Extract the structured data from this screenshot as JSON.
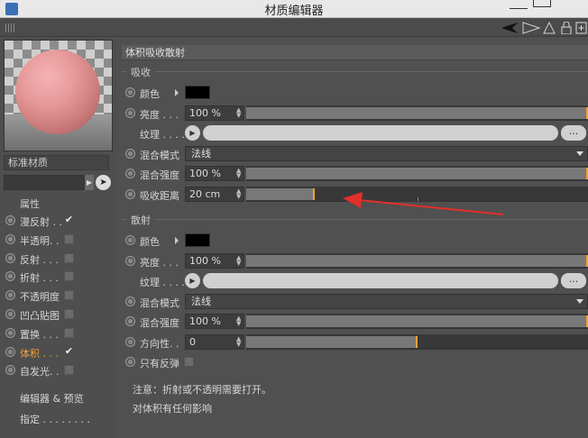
{
  "window": {
    "title": "材质编辑器"
  },
  "left_panel": {
    "material_name": "标准材质",
    "section_title": "属性",
    "channels": [
      {
        "label": "漫反射 . .",
        "checked": true
      },
      {
        "label": "半透明. .",
        "checked": false
      },
      {
        "label": "反射 . . .",
        "checked": false
      },
      {
        "label": "折射 . . .",
        "checked": false
      },
      {
        "label": "不透明度",
        "checked": false
      },
      {
        "label": "凹凸贴图",
        "checked": false
      },
      {
        "label": "置换 . . .",
        "checked": false
      },
      {
        "label": "体积 . . .",
        "checked": true,
        "active": true
      },
      {
        "label": "自发光. .",
        "checked": false
      }
    ],
    "footer": {
      "editor_preview": "编辑器 & 预览",
      "assign": "指定 . . . . . . . ."
    }
  },
  "main": {
    "header": "体积吸收散射",
    "absorption": {
      "group_title": "吸收",
      "color_label": "颜色",
      "brightness_label": "亮度 . . .",
      "brightness_value": "100 %",
      "brightness_level": 1.0,
      "texture_label": "纹理 . . . .",
      "texture_more": "...",
      "blend_mode_label": "混合模式",
      "blend_mode_value": "法线",
      "blend_strength_label": "混合强度",
      "blend_strength_value": "100 %",
      "blend_strength_level": 1.0,
      "distance_label": "吸收距离",
      "distance_value": "20 cm",
      "distance_level": 0.2
    },
    "scattering": {
      "group_title": "散射",
      "color_label": "颜色",
      "brightness_label": "亮度 . . .",
      "brightness_value": "100 %",
      "brightness_level": 1.0,
      "texture_label": "纹理 . . . .",
      "texture_more": "...",
      "blend_mode_label": "混合模式",
      "blend_mode_value": "法线",
      "blend_strength_label": "混合强度",
      "blend_strength_value": "100 %",
      "blend_strength_level": 1.0,
      "direction_label": "方向性. .",
      "direction_value": "0",
      "direction_level": 0.5,
      "only_reflection_label": "只有反弹"
    },
    "notes": [
      "注意：折射或不透明需要打开。",
      "对体积有任何影响"
    ]
  },
  "colors": {
    "accent": "#f0a23a",
    "annotation_arrow": "#e0302a"
  }
}
